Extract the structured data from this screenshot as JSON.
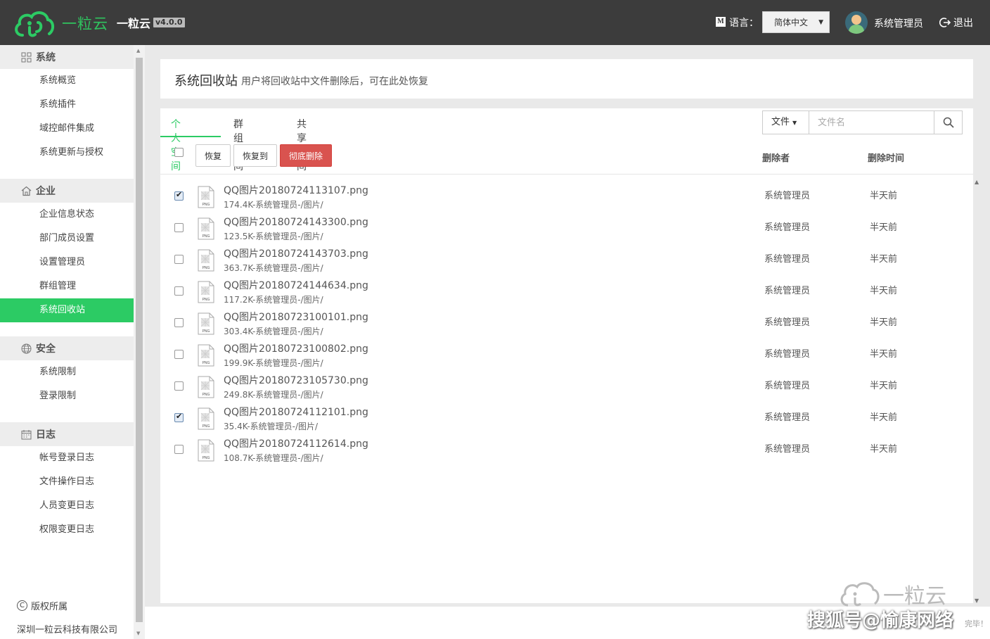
{
  "header": {
    "logo_text": "一粒云",
    "app_name": "一粒云",
    "version": "v4.0.0",
    "language_label": "语言：",
    "language_value": "简体中文",
    "user_name": "系统管理员",
    "logout_label": "退出",
    "brand_color": "#2ccb64"
  },
  "sidebar": {
    "groups": [
      {
        "label": "系统",
        "icon": "grid-icon",
        "items": [
          "系统概览",
          "系统插件",
          "域控邮件集成",
          "系统更新与授权"
        ]
      },
      {
        "label": "企业",
        "icon": "home-icon",
        "items": [
          "企业信息状态",
          "部门成员设置",
          "设置管理员",
          "群组管理",
          "系统回收站"
        ]
      },
      {
        "label": "安全",
        "icon": "globe-icon",
        "items": [
          "系统限制",
          "登录限制"
        ]
      },
      {
        "label": "日志",
        "icon": "calendar-icon",
        "items": [
          "帐号登录日志",
          "文件操作日志",
          "人员变更日志",
          "权限变更日志"
        ]
      }
    ],
    "active_item": "系统回收站",
    "copyright": "版权所属",
    "company": "深圳一粒云科技有限公司"
  },
  "page": {
    "title": "系统回收站",
    "subtitle": "用户将回收站中文件删除后，可在此处恢复"
  },
  "tabs": [
    "个人空间",
    "群组空间",
    "共享空间"
  ],
  "active_tab": "个人空间",
  "search": {
    "type_label": "文件",
    "placeholder": "文件名"
  },
  "toolbar": {
    "restore": "恢复",
    "restore_to": "恢复到",
    "delete_permanently": "彻底删除"
  },
  "columns": {
    "deleter": "删除者",
    "delete_time": "删除时间"
  },
  "files": [
    {
      "name": "QQ图片20180724113107.png",
      "meta": "174.4K-系统管理员-/图片/",
      "deleter": "系统管理员",
      "time": "半天前",
      "checked": true
    },
    {
      "name": "QQ图片20180724143300.png",
      "meta": "123.5K-系统管理员-/图片/",
      "deleter": "系统管理员",
      "time": "半天前",
      "checked": false
    },
    {
      "name": "QQ图片20180724143703.png",
      "meta": "363.7K-系统管理员-/图片/",
      "deleter": "系统管理员",
      "time": "半天前",
      "checked": false
    },
    {
      "name": "QQ图片20180724144634.png",
      "meta": "117.2K-系统管理员-/图片/",
      "deleter": "系统管理员",
      "time": "半天前",
      "checked": false
    },
    {
      "name": "QQ图片20180723100101.png",
      "meta": "303.4K-系统管理员-/图片/",
      "deleter": "系统管理员",
      "time": "半天前",
      "checked": false
    },
    {
      "name": "QQ图片20180723100802.png",
      "meta": "199.9K-系统管理员-/图片/",
      "deleter": "系统管理员",
      "time": "半天前",
      "checked": false
    },
    {
      "name": "QQ图片20180723105730.png",
      "meta": "249.8K-系统管理员-/图片/",
      "deleter": "系统管理员",
      "time": "半天前",
      "checked": false
    },
    {
      "name": "QQ图片20180724112101.png",
      "meta": "35.4K-系统管理员-/图片/",
      "deleter": "系统管理员",
      "time": "半天前",
      "checked": true
    },
    {
      "name": "QQ图片20180724112614.png",
      "meta": "108.7K-系统管理员-/图片/",
      "deleter": "系统管理员",
      "time": "半天前",
      "checked": false
    }
  ],
  "file_type_label": "PNG",
  "status_text": "完毕！",
  "watermark": {
    "logo_text": "一粒云",
    "sohu_text": "搜狐号@愉康网络"
  }
}
